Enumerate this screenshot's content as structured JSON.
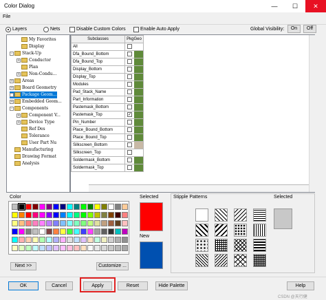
{
  "window": {
    "title": "Color Dialog",
    "minimize": "—",
    "maximize": "☐",
    "close": "✕"
  },
  "menu": {
    "file": "File"
  },
  "options": {
    "layers_label": "Layers",
    "nets_label": "Nets",
    "disable_custom_colors": "Disable Custom Colors",
    "enable_auto_apply": "Enable Auto Apply",
    "global_visibility": "Global Visibility:",
    "on": "On",
    "off": "Off"
  },
  "tree": [
    {
      "label": "My Favorites",
      "indent": 1,
      "exp": ""
    },
    {
      "label": "Display",
      "indent": 1,
      "exp": ""
    },
    {
      "label": "Stack-Up",
      "indent": 0,
      "exp": "-"
    },
    {
      "label": "Conductor",
      "indent": 1,
      "exp": "+"
    },
    {
      "label": "Plan",
      "indent": 1,
      "exp": ""
    },
    {
      "label": "Non-Condu...",
      "indent": 1,
      "exp": "+"
    },
    {
      "label": "Areas",
      "indent": 0,
      "exp": "+"
    },
    {
      "label": "Board Geometry",
      "indent": 0,
      "exp": "+"
    },
    {
      "label": "Package Geom...",
      "indent": 0,
      "exp": "+",
      "selected": true
    },
    {
      "label": "Embedded Geom...",
      "indent": 0,
      "exp": "+"
    },
    {
      "label": "Components",
      "indent": 0,
      "exp": "-"
    },
    {
      "label": "Component V...",
      "indent": 1,
      "exp": "+"
    },
    {
      "label": "Device Type",
      "indent": 1,
      "exp": "+"
    },
    {
      "label": "Ref Des",
      "indent": 1,
      "exp": ""
    },
    {
      "label": "Tolerance",
      "indent": 1,
      "exp": ""
    },
    {
      "label": "User Part Nu",
      "indent": 1,
      "exp": ""
    },
    {
      "label": "Manufacturing",
      "indent": 0,
      "exp": ""
    },
    {
      "label": "Drawing Format",
      "indent": 0,
      "exp": ""
    },
    {
      "label": "Analysis",
      "indent": 0,
      "exp": ""
    }
  ],
  "subclasses": {
    "header_name": "Subclasses",
    "header_pkg": "PkgGeo",
    "rows": [
      {
        "name": "All",
        "checked": false,
        "color": "#ffffff"
      },
      {
        "name": "Dfa_Bound_Bottom",
        "checked": false,
        "color": "#5f8a3a"
      },
      {
        "name": "Dfa_Bound_Top",
        "checked": false,
        "color": "#5f8a3a"
      },
      {
        "name": "Display_Bottom",
        "checked": false,
        "color": "#5f8a3a"
      },
      {
        "name": "Display_Top",
        "checked": false,
        "color": "#5f8a3a"
      },
      {
        "name": "Modules",
        "checked": false,
        "color": "#5f8a3a"
      },
      {
        "name": "Pad_Stack_Name",
        "checked": false,
        "color": "#5f8a3a"
      },
      {
        "name": "Part_Information",
        "checked": false,
        "color": "#5f8a3a"
      },
      {
        "name": "Pastemask_Bottom",
        "checked": false,
        "color": "#5f8a3a"
      },
      {
        "name": "Pastemask_Top",
        "checked": true,
        "color": "#5f8a3a"
      },
      {
        "name": "Pin_Number",
        "checked": false,
        "color": "#5f8a3a"
      },
      {
        "name": "Place_Bound_Bottom",
        "checked": false,
        "color": "#5f8a3a"
      },
      {
        "name": "Place_Bound_Top",
        "checked": false,
        "color": "#5f8a3a"
      },
      {
        "name": "Silkscreen_Bottom",
        "checked": false,
        "color": "#c8b9a6"
      },
      {
        "name": "Silkscreen_Top",
        "checked": false,
        "color": "#ffffff"
      },
      {
        "name": "Soldermask_Bottom",
        "checked": false,
        "color": "#5f8a3a"
      },
      {
        "name": "Soldermask_Top",
        "checked": false,
        "color": "#5f8a3a"
      }
    ]
  },
  "color_section": {
    "label": "Color",
    "next_button": "Next >>",
    "customize_button": "Customize ..."
  },
  "palette": [
    [
      "#c0c0c0",
      "#000000",
      "#ff0000",
      "#800000",
      "#ff00ff",
      "#800080",
      "#0000ff",
      "#000080",
      "#00ffff",
      "#008080",
      "#00ff00",
      "#008000",
      "#ffff00",
      "#808000",
      "#ffffff",
      "#808080",
      "#ffcc99"
    ],
    [
      "#ffff00",
      "#ff8000",
      "#ff0000",
      "#ff0080",
      "#ff00ff",
      "#8000ff",
      "#0000ff",
      "#0080ff",
      "#00ffff",
      "#00ff80",
      "#00ff00",
      "#80ff00",
      "#c0c000",
      "#808040",
      "#804000",
      "#400000",
      "#ff8080"
    ],
    [
      "#ffff80",
      "#ffc080",
      "#ff8080",
      "#ff80c0",
      "#ff80ff",
      "#c080ff",
      "#8080ff",
      "#80c0ff",
      "#80ffff",
      "#80ffc0",
      "#80ff80",
      "#c0ff80",
      "#e0e0a0",
      "#c0a080",
      "#a06040",
      "#604020",
      "#ffc0c0"
    ],
    [
      "#0000ff",
      "#ff00ff",
      "#808080",
      "#c0c0c0",
      "#ffffff",
      "#804040",
      "#ff8040",
      "#ffff40",
      "#40ff40",
      "#40ffff",
      "#4040ff",
      "#ff40ff",
      "#a0a0a0",
      "#606060",
      "#303030",
      "#00c0c0",
      "#c000c0"
    ],
    [
      "#00ffff",
      "#ffb0b0",
      "#ffd0b0",
      "#ffffb0",
      "#b0ffb0",
      "#b0ffff",
      "#b0b0ff",
      "#ffb0ff",
      "#e0e0e0",
      "#c0e0ff",
      "#e0c0ff",
      "#ffe0c0",
      "#c0ffe0",
      "#f0f0c0",
      "#d0d0d0",
      "#b0b0b0",
      "#909090"
    ],
    [
      "#ffffc0",
      "#e0ffc0",
      "#c0ffc0",
      "#c0ffff",
      "#c0e0ff",
      "#c0c0ff",
      "#e0c0ff",
      "#ffc0ff",
      "#ffc0e0",
      "#ffc0c0",
      "#ffe0c0",
      "#f8f8f8",
      "#e8e8e8",
      "#d8d8d8",
      "#c8c8c8",
      "#b8b8b8",
      "#a8a8a8"
    ]
  ],
  "selected": {
    "label": "Selected",
    "new_label": "New",
    "selected_color": "#ff0000",
    "new_color": "#0050b0"
  },
  "stipple": {
    "label": "Stipple Patterns",
    "selected_label": "Selected"
  },
  "buttons": {
    "ok": "OK",
    "cancel": "Cancel",
    "apply": "Apply",
    "reset": "Reset",
    "hide_palette": "Hide Palette",
    "help": "Help"
  },
  "highlight_color": "#e02020",
  "watermark": "CSDN @天行健"
}
